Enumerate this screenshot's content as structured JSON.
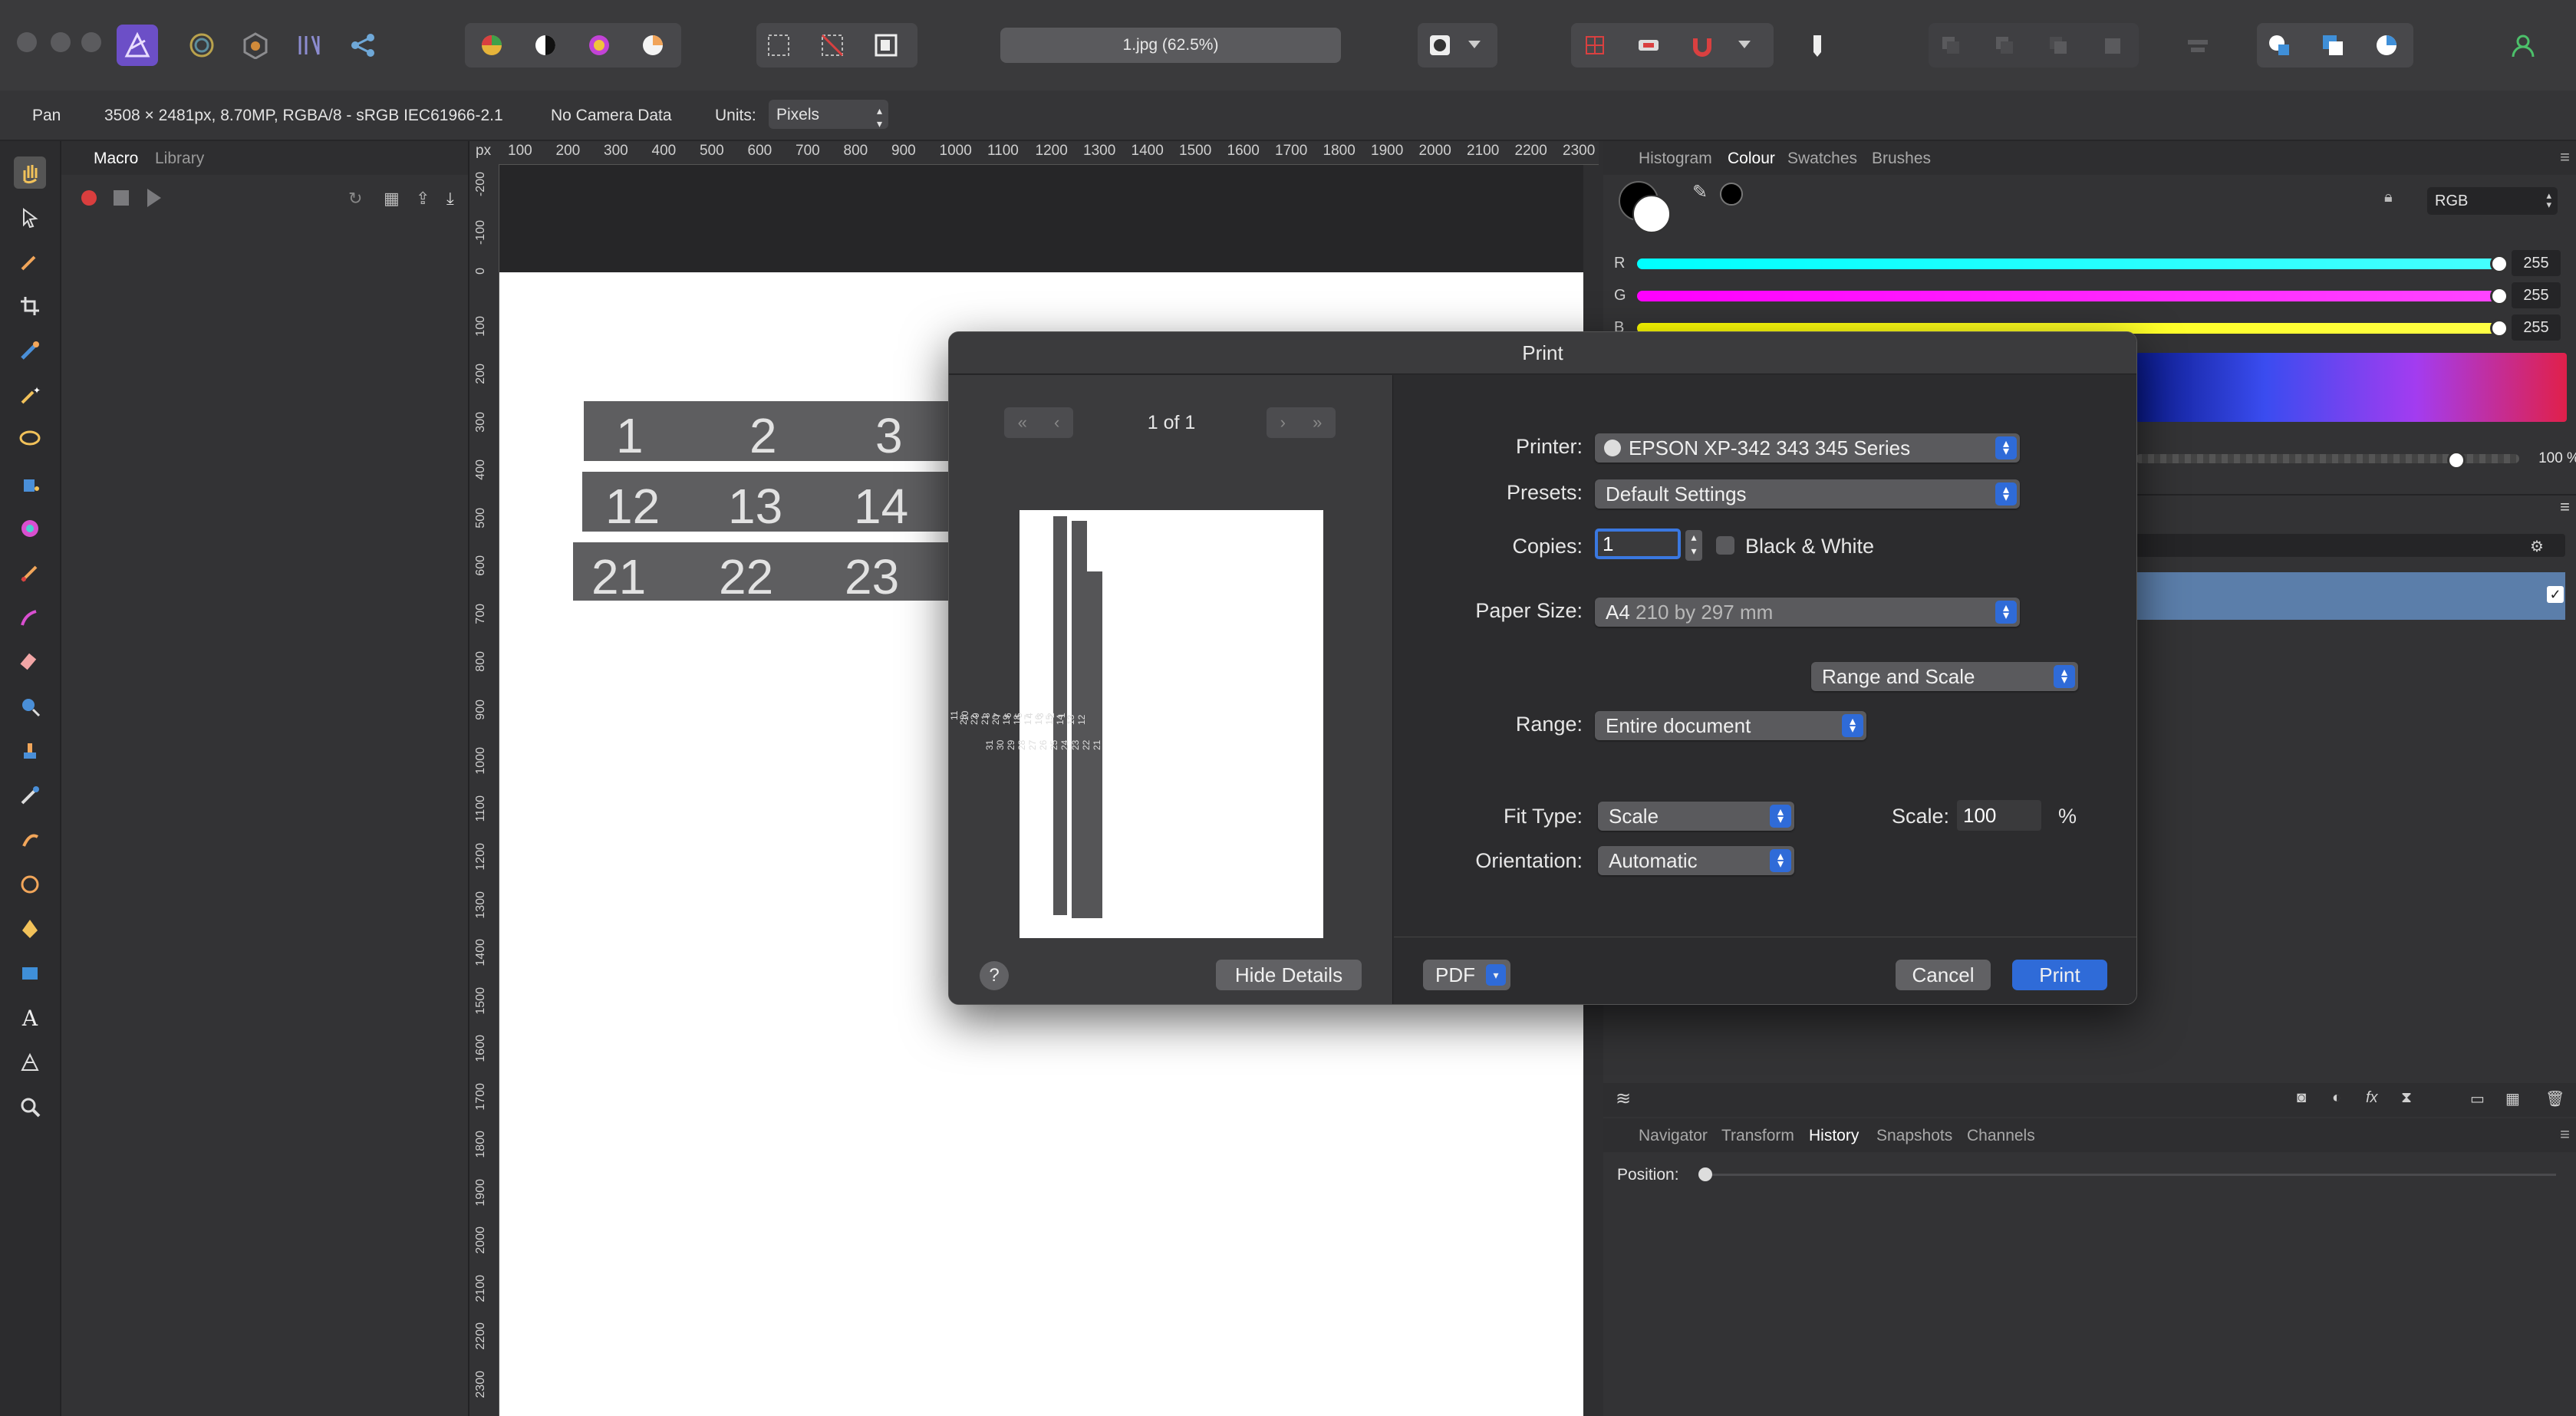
{
  "document": {
    "title": "1.jpg (62.5%)"
  },
  "context": {
    "tool": "Pan",
    "info": "3508 × 2481px, 8.70MP, RGBA/8 - sRGB IEC61966-2.1",
    "camera": "No Camera Data",
    "units_label": "Units:",
    "units_value": "Pixels"
  },
  "macro_panel": {
    "tabs": [
      "Macro",
      "Library"
    ]
  },
  "ruler": {
    "unit": "px",
    "top_ticks": [
      "100",
      "200",
      "300",
      "400",
      "500",
      "600",
      "700",
      "800",
      "900",
      "1000",
      "1100",
      "1200",
      "1300",
      "1400",
      "1500",
      "1600",
      "1700",
      "1800",
      "1900",
      "2000",
      "2100",
      "2200",
      "2300"
    ],
    "left_ticks": [
      "-200",
      "-100",
      "0",
      "100",
      "200",
      "300",
      "400",
      "500",
      "600",
      "700",
      "800",
      "900",
      "1000",
      "1100",
      "1200",
      "1300",
      "1400",
      "1500",
      "1600",
      "1700",
      "1800",
      "1900",
      "2000",
      "2100",
      "2200",
      "2300"
    ]
  },
  "canvas": {
    "row1": [
      "1",
      "2",
      "3"
    ],
    "row2": [
      "12",
      "13",
      "14"
    ],
    "row3": [
      "21",
      "22",
      "23"
    ]
  },
  "colour_panel": {
    "tabs": [
      "Histogram",
      "Colour",
      "Swatches",
      "Brushes"
    ],
    "model": "RGB",
    "r_label": "R",
    "r_value": "255",
    "g_label": "G",
    "g_value": "255",
    "b_label": "B",
    "b_value": "255",
    "opacity": "100 %"
  },
  "bottom_panel": {
    "tabs": [
      "Navigator",
      "Transform",
      "History",
      "Snapshots",
      "Channels"
    ],
    "position_label": "Position:"
  },
  "print_dialog": {
    "title": "Print",
    "page_indicator": "1 of 1",
    "printer_label": "Printer:",
    "printer_value": "EPSON XP-342 343 345 Series",
    "presets_label": "Presets:",
    "presets_value": "Default Settings",
    "copies_label": "Copies:",
    "copies_value": "1",
    "bw_label": "Black & White",
    "paper_label": "Paper Size:",
    "paper_value": "A4",
    "paper_dims": "210 by 297 mm",
    "section_value": "Range and Scale",
    "range_label": "Range:",
    "range_value": "Entire document",
    "fit_label": "Fit Type:",
    "fit_value": "Scale",
    "scale_label": "Scale:",
    "scale_value": "100",
    "scale_unit": "%",
    "orientation_label": "Orientation:",
    "orientation_value": "Automatic",
    "help_label": "?",
    "hide_details_label": "Hide Details",
    "pdf_label": "PDF",
    "cancel_label": "Cancel",
    "print_label": "Print",
    "preview_col1": [
      "1",
      "2",
      "3",
      "4",
      "5",
      "6",
      "7",
      "8",
      "9",
      "10",
      "11",
      "12"
    ],
    "preview_col2": [
      "12",
      "13",
      "14",
      "15",
      "16",
      "17",
      "18",
      "19",
      "20",
      "21",
      "22",
      "23"
    ],
    "preview_col3": [
      "21",
      "22",
      "23",
      "24",
      "25",
      "26",
      "27",
      "28",
      "29",
      "30",
      "31"
    ]
  },
  "colors": {
    "accent": "#2f6bd8",
    "app_bg": "#2f2f31",
    "dialog_bg": "#2c2c2e"
  }
}
